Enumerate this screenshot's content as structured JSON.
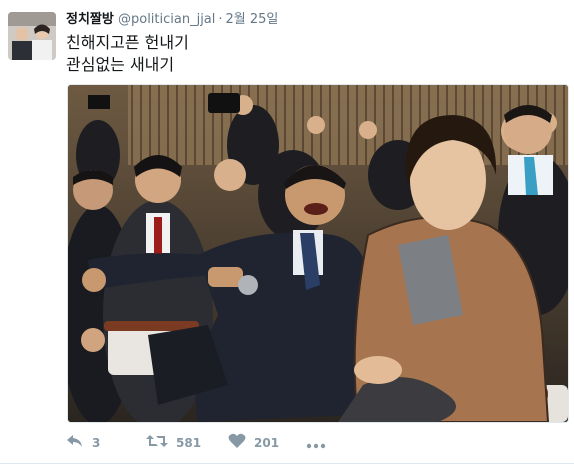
{
  "tweet": {
    "author_name": "정치짤방",
    "handle": "@politician_jjal",
    "separator": "·",
    "date": "2월 25일",
    "text_lines": [
      "친해지고픈 헌내기",
      "관심없는 새내기"
    ]
  },
  "actions": {
    "reply_count": "3",
    "retweet_count": "581",
    "like_count": "201",
    "icons": {
      "reply": "reply-icon",
      "retweet": "retweet-icon",
      "like": "heart-icon",
      "more": "more-icon"
    }
  },
  "colors": {
    "text": "#14171a",
    "muted": "#657786",
    "action": "#8899a6",
    "border": "#e1e8ed"
  }
}
